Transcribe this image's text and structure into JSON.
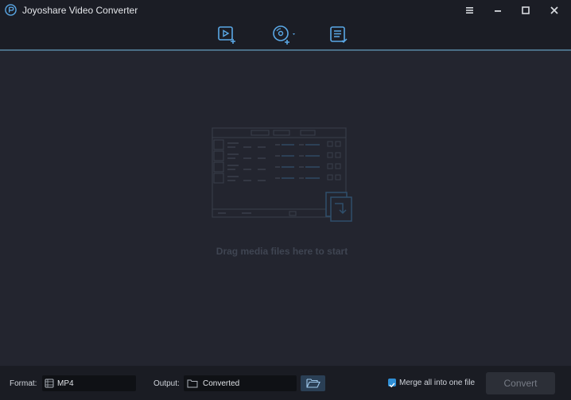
{
  "app": {
    "title": "Joyoshare Video Converter"
  },
  "window": {
    "menu_icon": "hamburger-icon",
    "minimize_icon": "minimize-icon",
    "maximize_icon": "maximize-icon",
    "close_icon": "close-icon"
  },
  "toolbar": {
    "buttons": [
      {
        "icon": "add-video-icon"
      },
      {
        "icon": "add-dvd-icon"
      },
      {
        "icon": "task-list-icon"
      }
    ]
  },
  "drop_area": {
    "text": "Drag media files here to start"
  },
  "bottom": {
    "format_label": "Format:",
    "format_value": "MP4",
    "output_label": "Output:",
    "output_value": "Converted",
    "merge_label": "Merge all into one file",
    "merge_checked": true,
    "convert_label": "Convert"
  },
  "colors": {
    "accent": "#2f8fd6",
    "background": "#23252f",
    "toolbar": "#1b1d25",
    "bottom_bar": "#1a1c23"
  }
}
